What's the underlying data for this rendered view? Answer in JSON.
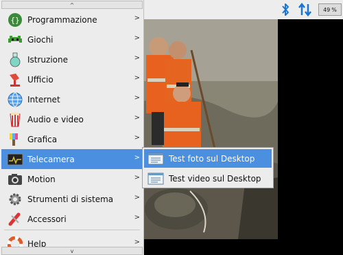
{
  "panel": {
    "cpu_value": "49",
    "cpu_unit": "%",
    "icons": [
      "bluetooth-icon",
      "network-arrows-icon"
    ],
    "accent": "#1a74d2"
  },
  "menu": {
    "scroll_up": "^",
    "scroll_down": "v",
    "selected_color": "#4a8fe0",
    "items": [
      {
        "label": "Programmazione",
        "icon": "programming-icon"
      },
      {
        "label": "Giochi",
        "icon": "games-icon"
      },
      {
        "label": "Istruzione",
        "icon": "education-icon"
      },
      {
        "label": "Ufficio",
        "icon": "office-icon"
      },
      {
        "label": "Internet",
        "icon": "internet-globe-icon"
      },
      {
        "label": "Audio e video",
        "icon": "audio-video-icon"
      },
      {
        "label": "Grafica",
        "icon": "graphics-icon"
      },
      {
        "label": "Telecamera",
        "icon": "camera-monitor-icon"
      },
      {
        "label": "Motion",
        "icon": "motion-camera-icon"
      },
      {
        "label": "Strumenti di sistema",
        "icon": "system-tools-icon"
      },
      {
        "label": "Accessori",
        "icon": "accessories-icon"
      },
      {
        "label": "Help",
        "icon": "help-lifebuoy-icon"
      }
    ],
    "arrow": ">"
  },
  "submenu": {
    "items": [
      {
        "label": "Test foto sul Desktop",
        "icon": "desktop-file-icon"
      },
      {
        "label": "Test video sul Desktop",
        "icon": "desktop-file-icon"
      }
    ]
  }
}
